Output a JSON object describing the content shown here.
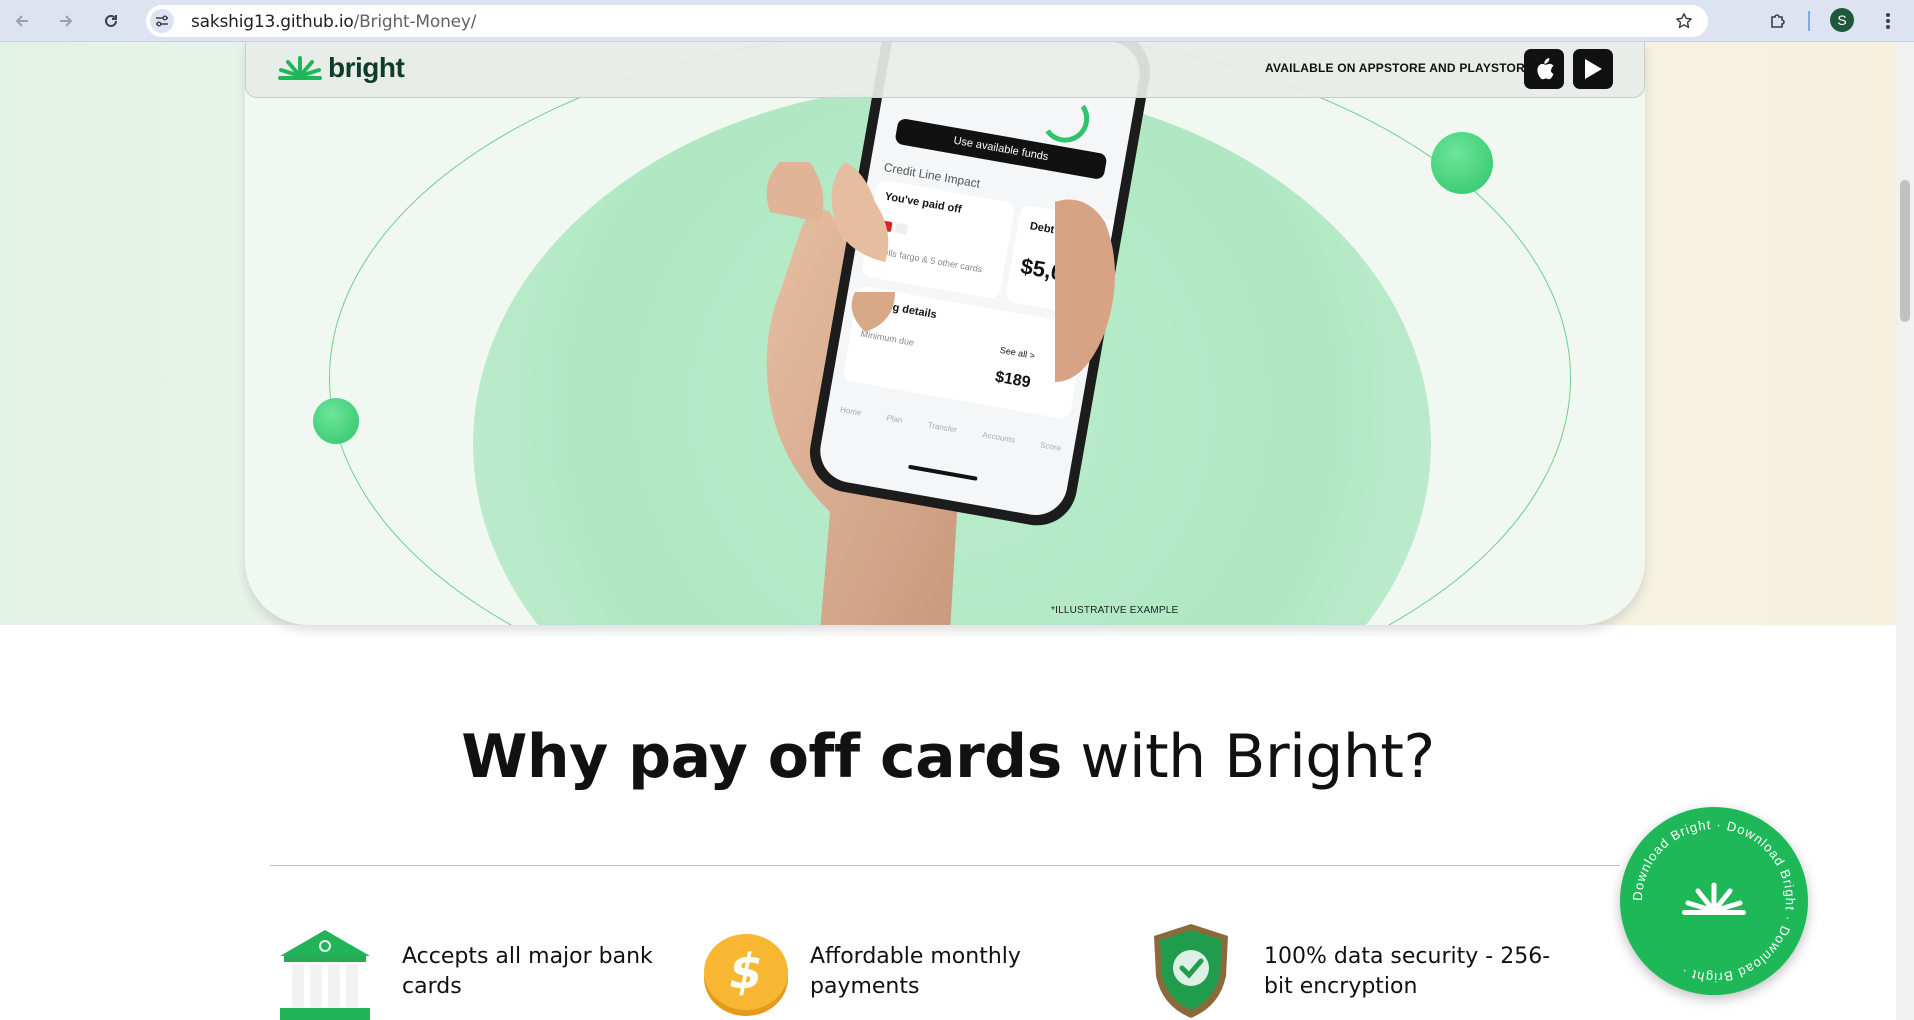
{
  "browser": {
    "url_host": "sakshig13.github.io",
    "url_path": "/Bright-Money/",
    "profile_initial": "S"
  },
  "nav": {
    "brand": "bright",
    "available_text": "AVAILABLE ON APPSTORE AND PLAYSTORE"
  },
  "hero": {
    "phone": {
      "use_funds_button": "Use available funds",
      "credit_line_title": "Credit Line Impact",
      "paid_off_label": "You've paid off",
      "paid_off_sub": "Wells fargo & 5 other cards",
      "debt_crushed_label": "Debt crushed",
      "debt_crushed_value": "$5,000.",
      "billing_label": "Billing details",
      "see_all": "See all >",
      "min_due_label": "Minimum due",
      "min_due_value": "$189",
      "tabs": [
        "Home",
        "Plan",
        "Transfer",
        "Accounts",
        "Score"
      ]
    },
    "illustrative_note": "*ILLUSTRATIVE EXAMPLE"
  },
  "why": {
    "title_bold": "Why pay off cards",
    "title_rest": " with Bright?"
  },
  "features": [
    {
      "icon": "bank-icon",
      "text": "Accepts all major bank cards"
    },
    {
      "icon": "dollar-coin-icon",
      "text": "Affordable monthly payments"
    },
    {
      "icon": "shield-check-icon",
      "text": "100% data security - 256-bit encryption"
    }
  ],
  "download_badge": {
    "ring_text": "Download Bright · Download Bright · Download Bright ·"
  },
  "colors": {
    "brand_green": "#1fb858",
    "brand_dark": "#0d3b2c",
    "hero_circle": "#b0e8c3"
  }
}
